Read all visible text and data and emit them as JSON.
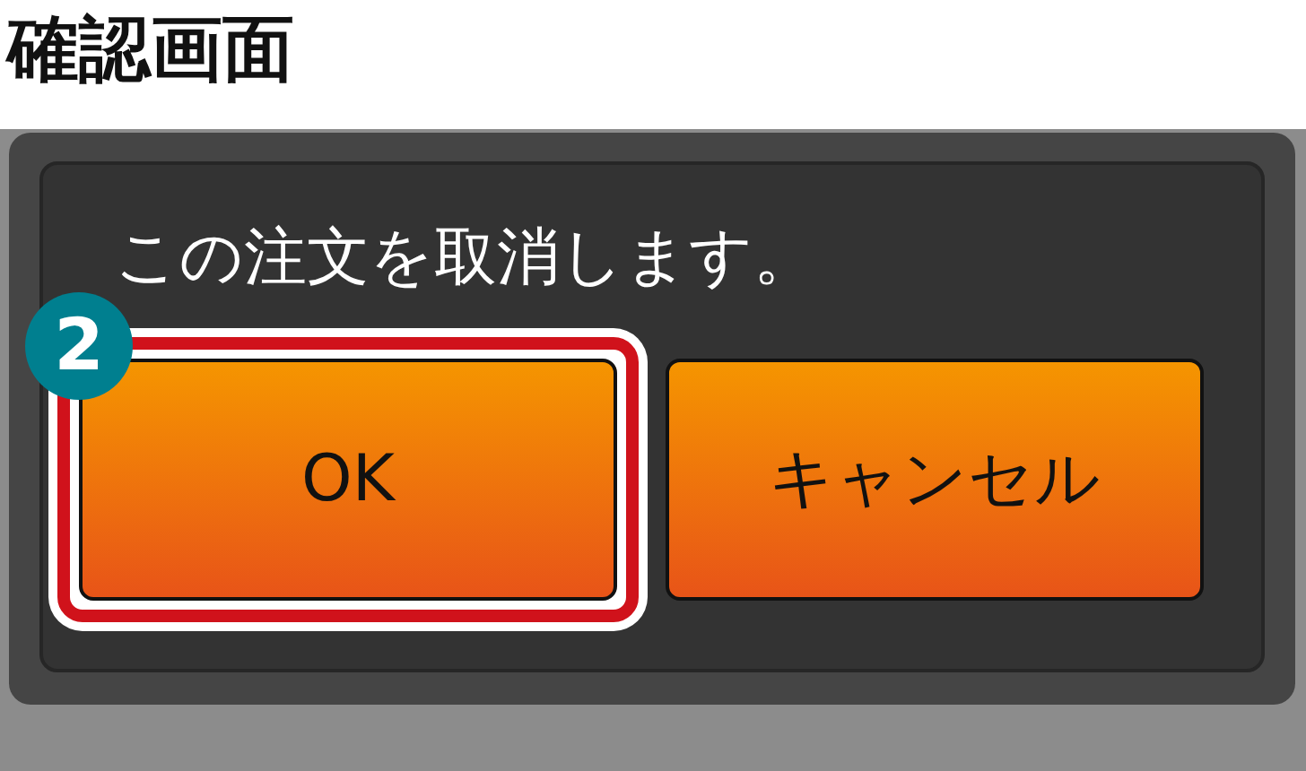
{
  "title": "確認画面",
  "dialog": {
    "message": "この注文を取消します。",
    "buttons": [
      {
        "label": "OK",
        "highlighted": true,
        "callout": "2"
      },
      {
        "label": "キャンセル",
        "highlighted": false
      }
    ]
  }
}
